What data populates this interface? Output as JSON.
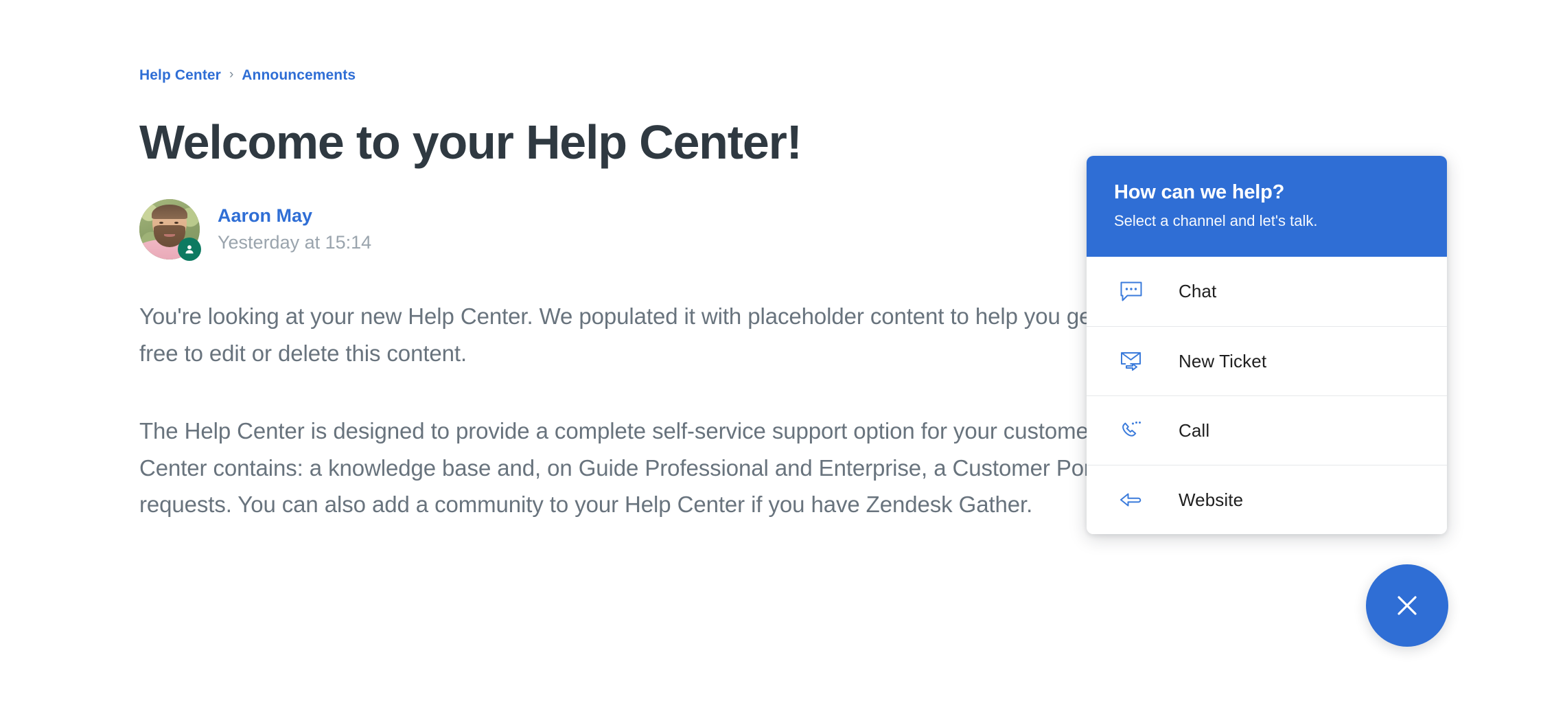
{
  "breadcrumb": {
    "items": [
      {
        "label": "Help Center"
      },
      {
        "label": "Announcements"
      }
    ],
    "separator": "›"
  },
  "article": {
    "title": "Welcome to your Help Center!",
    "author_name": "Aaron May",
    "published": "Yesterday at 15:14",
    "paragraphs": [
      "You're looking at your new Help Center. We populated it with placeholder content to help you get started. Feel free to edit or delete this content.",
      "The Help Center is designed to provide a complete self-service support option for your customers. The Help Center contains: a knowledge base and, on Guide Professional and Enterprise, a Customer Portal for support requests. You can also add a community to your Help Center if you have Zendesk Gather."
    ]
  },
  "widget": {
    "title": "How can we help?",
    "subtitle": "Select a channel and let's talk.",
    "channels": [
      {
        "label": "Chat",
        "icon": "chat-bubble-icon"
      },
      {
        "label": "New Ticket",
        "icon": "envelope-arrow-icon"
      },
      {
        "label": "Call",
        "icon": "phone-handset-icon"
      },
      {
        "label": "Website",
        "icon": "arrow-left-icon"
      }
    ]
  },
  "launcher": {
    "icon": "close-icon",
    "label": "Close"
  },
  "colors": {
    "brand_blue": "#2f6ed5",
    "title_text": "#2f3941",
    "body_text": "#68737d",
    "muted_text": "#9aa4ad",
    "badge_green": "#0d7a61",
    "divider": "#e6e8ea"
  }
}
